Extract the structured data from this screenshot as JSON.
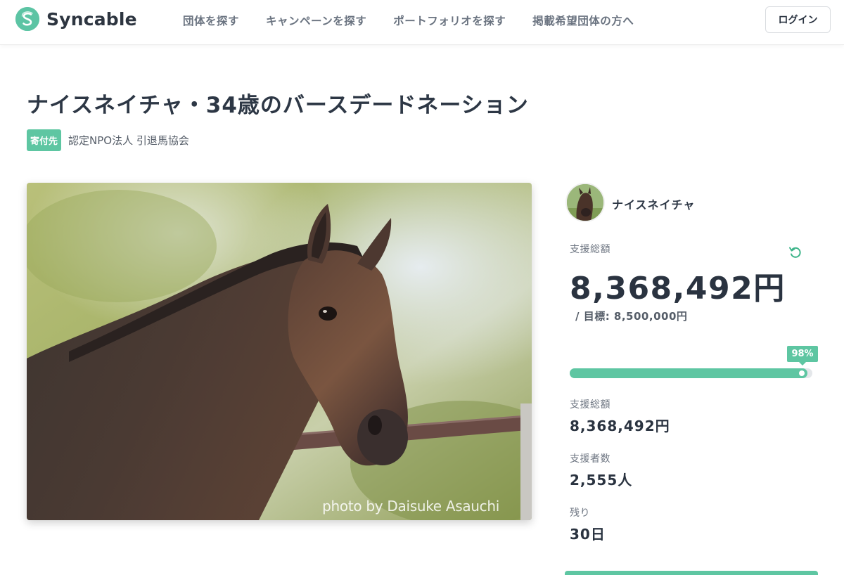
{
  "brand": {
    "name": "Syncable",
    "logo_letter": "S",
    "accent": "#5ec6a2"
  },
  "nav": {
    "items": [
      "団体を探す",
      "キャンペーンを探す",
      "ポートフォリオを探す",
      "掲載希望団体の方へ"
    ],
    "login_label": "ログイン"
  },
  "campaign": {
    "title": "ナイスネイチャ・34歳のバースデードネーション",
    "badge": "寄付先",
    "org": "認定NPO法人 引退馬協会",
    "photo_credit": "photo by Daisuke Asauchi"
  },
  "panel": {
    "owner_name": "ナイスネイチャ",
    "total_label": "支援総額",
    "total_amount": "8,368,492円",
    "goal_text": "/ 目標: 8,500,000円",
    "progress_percent": 98,
    "progress_label": "98%",
    "stats": [
      {
        "label": "支援総額",
        "value": "8,368,492円"
      },
      {
        "label": "支援者数",
        "value": "2,555人"
      },
      {
        "label": "残り",
        "value": "30日"
      }
    ]
  },
  "icons": {
    "refresh": "refresh-icon",
    "logo": "syncable-logo-icon"
  }
}
